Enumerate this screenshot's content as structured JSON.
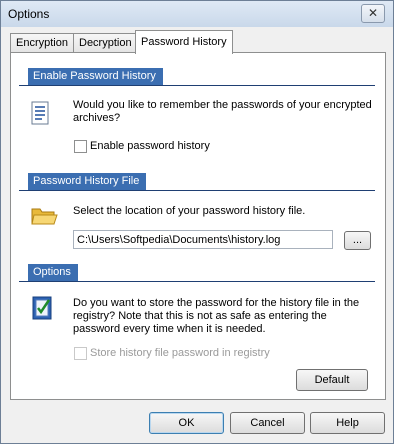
{
  "window": {
    "title": "Options",
    "close_glyph": "✕"
  },
  "tabs": [
    {
      "label": "Encryption"
    },
    {
      "label": "Decryption"
    },
    {
      "label": "Password History"
    }
  ],
  "enable_section": {
    "header": "Enable Password History",
    "question": "Would you like to remember the passwords of your encrypted archives?",
    "checkbox_label": "Enable password history",
    "checkbox_checked": false,
    "icon": "document-icon"
  },
  "file_section": {
    "header": "Password History File",
    "prompt": "Select the location of your password history file.",
    "path_value": "C:\\Users\\Softpedia\\Documents\\history.log",
    "browse_label": "...",
    "icon": "folder-icon"
  },
  "options_section": {
    "header": "Options",
    "question": "Do you want to store the password for the history file in the registry? Note that this is not as safe as entering the password every time when it is needed.",
    "checkbox_label": "Store history file password in registry",
    "checkbox_checked": false,
    "default_label": "Default",
    "icon": "checklist-icon"
  },
  "footer": {
    "ok_label": "OK",
    "cancel_label": "Cancel",
    "help_label": "Help"
  }
}
